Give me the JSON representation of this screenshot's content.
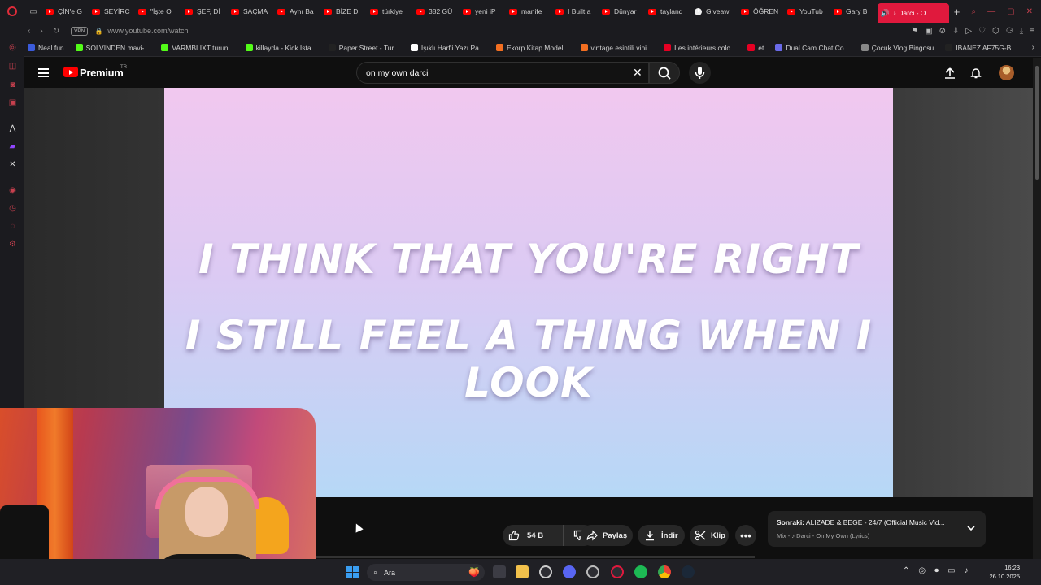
{
  "browser": {
    "tabs": [
      {
        "label": "ÇİN'e G",
        "icon": "youtube-icon"
      },
      {
        "label": "SEYİRC",
        "icon": "youtube-icon"
      },
      {
        "label": "\"İşte O",
        "icon": "youtube-icon"
      },
      {
        "label": "ŞEF, Dİ",
        "icon": "youtube-icon"
      },
      {
        "label": "SAÇMA",
        "icon": "youtube-icon"
      },
      {
        "label": "Aynı Ba",
        "icon": "youtube-icon"
      },
      {
        "label": "BİZE Dİ",
        "icon": "youtube-icon"
      },
      {
        "label": "türkiye",
        "icon": "youtube-icon"
      },
      {
        "label": "382 GÜ",
        "icon": "youtube-icon"
      },
      {
        "label": "yeni iP",
        "icon": "youtube-icon"
      },
      {
        "label": "manife",
        "icon": "youtube-icon"
      },
      {
        "label": "I Built a",
        "icon": "youtube-icon"
      },
      {
        "label": "Dünyar",
        "icon": "youtube-icon"
      },
      {
        "label": "tayland",
        "icon": "youtube-icon"
      },
      {
        "label": "Giveaw",
        "icon": "openai-icon"
      },
      {
        "label": "ÖĞREN",
        "icon": "youtube-icon"
      },
      {
        "label": "YouTub",
        "icon": "youtube-icon"
      },
      {
        "label": "Gary B",
        "icon": "youtube-icon"
      }
    ],
    "active_tab": "♪ Darci - O",
    "url": "www.youtube.com/watch",
    "vpn": "VPN",
    "bookmarks": [
      {
        "label": "Neal.fun",
        "color": "#3b5bdb"
      },
      {
        "label": "SOLVINDEN mavi-...",
        "color": "#53fc18"
      },
      {
        "label": "VARMBLIXT turun...",
        "color": "#53fc18"
      },
      {
        "label": "killayda - Kick İsta...",
        "color": "#53fc18"
      },
      {
        "label": "Paper Street - Tur...",
        "color": "#222222"
      },
      {
        "label": "Işıklı Harfli Yazı Pa...",
        "color": "#ffffff"
      },
      {
        "label": "Ekorp Kitap Model...",
        "color": "#f36f21"
      },
      {
        "label": "vintage esintili vini...",
        "color": "#f36f21"
      },
      {
        "label": "Les intérieurs colo...",
        "color": "#e60023"
      },
      {
        "label": "et",
        "color": "#e60023"
      },
      {
        "label": "Dual Cam Chat Co...",
        "color": "#6a6ae8"
      },
      {
        "label": "Çocuk Vlog Bingosu",
        "color": "#888888"
      },
      {
        "label": "IBANEZ AF75G-B...",
        "color": "#222222"
      }
    ]
  },
  "youtube": {
    "brand": "Premium",
    "region": "TR",
    "search_query": "on my own darci",
    "lyrics": [
      "I THINK THAT YOU'RE RIGHT",
      "I STILL FEEL A THING WHEN I LOOK"
    ],
    "likes": "54 B",
    "share_label": "Paylaş",
    "download_label": "İndir",
    "clip_label": "Klip",
    "more_label": "•••",
    "next_prefix": "Sonraki:",
    "next_title": "ALIZADE & BEGE - 24/7 (Official Music Vid...",
    "next_subtitle": "Mix - ♪ Darci - On My Own (Lyrics)"
  },
  "taskbar": {
    "search_placeholder": "Ara",
    "time": "16:23",
    "date": "26.10.2025"
  },
  "colors": {
    "accent": "#ff0000",
    "opera_red": "#e0193d",
    "windows_blue": "#3a9df0"
  }
}
